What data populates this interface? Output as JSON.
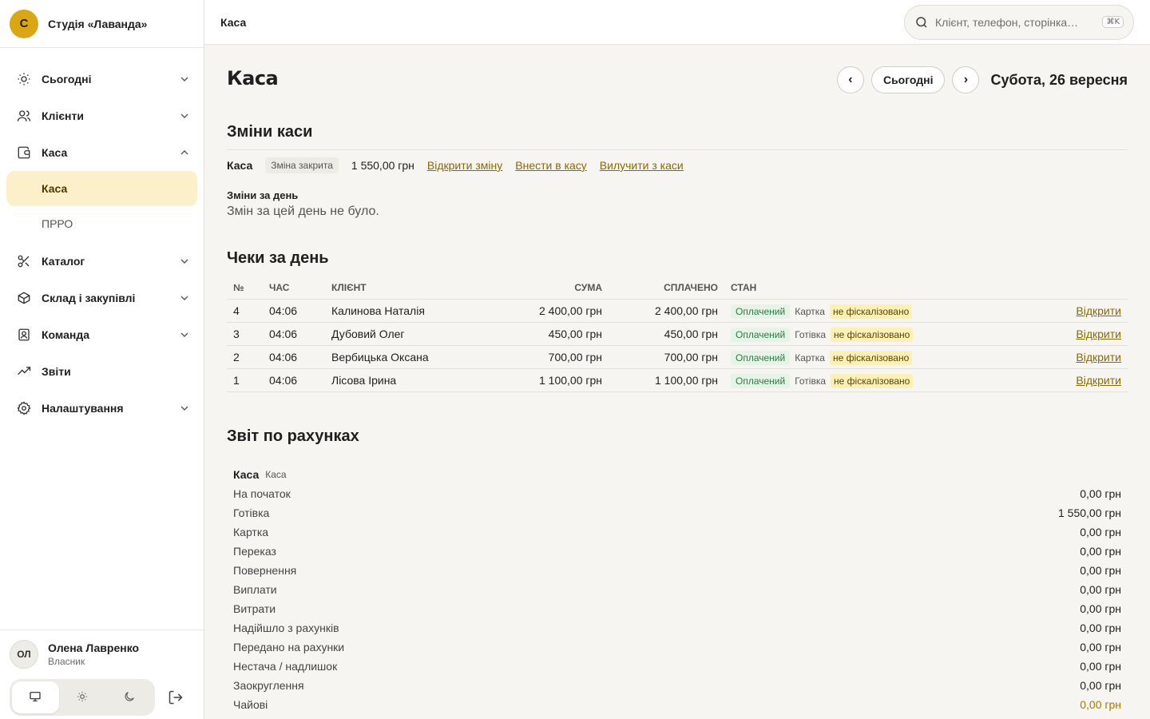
{
  "brand": {
    "initial": "С",
    "name": "Студія «Лаванда»"
  },
  "sidebar": {
    "items": [
      {
        "label": "Сьогодні"
      },
      {
        "label": "Клієнти"
      },
      {
        "label": "Каса"
      },
      {
        "label": "Каталог"
      },
      {
        "label": "Склад і закупівлі"
      },
      {
        "label": "Команда"
      },
      {
        "label": "Звіти"
      },
      {
        "label": "Налаштування"
      }
    ],
    "sub_items": [
      {
        "label": "Каса"
      },
      {
        "label": "ПРРО"
      }
    ]
  },
  "user": {
    "initials": "ОЛ",
    "name": "Олена Лавренко",
    "role": "Власник"
  },
  "topbar": {
    "title": "Каса",
    "search_placeholder": "Клієнт, телефон, сторінка…",
    "shortcut": "⌘K"
  },
  "page": {
    "title": "Каса",
    "prev": "‹",
    "today": "Сьогодні",
    "next": "›",
    "date": "Субота, 26 вересня"
  },
  "shifts": {
    "title": "Зміни каси",
    "register_name": "Каса",
    "status": "Зміна закрита",
    "amount": "1 550,00 грн",
    "open_shift": "Відкрити зміну",
    "deposit": "Внести в касу",
    "withdraw": "Вилучити з каси",
    "day_heading": "Зміни за день",
    "day_empty": "Змін за цей день не було."
  },
  "receipts": {
    "title": "Чеки за день",
    "columns": [
      "№",
      "Час",
      "Клієнт",
      "Сума",
      "Сплачено",
      "Стан"
    ],
    "rows": [
      {
        "no": "4",
        "time": "04:06",
        "client": "Калинова Наталія",
        "sum": "2 400,00 грн",
        "paid": "2 400,00 грн",
        "status": "Оплачений",
        "method": "Картка",
        "fiscal": "не фіскалізовано",
        "action": "Відкрити"
      },
      {
        "no": "3",
        "time": "04:06",
        "client": "Дубовий Олег",
        "sum": "450,00 грн",
        "paid": "450,00 грн",
        "status": "Оплачений",
        "method": "Готівка",
        "fiscal": "не фіскалізовано",
        "action": "Відкрити"
      },
      {
        "no": "2",
        "time": "04:06",
        "client": "Вербицька Оксана",
        "sum": "700,00 грн",
        "paid": "700,00 грн",
        "status": "Оплачений",
        "method": "Картка",
        "fiscal": "не фіскалізовано",
        "action": "Відкрити"
      },
      {
        "no": "1",
        "time": "04:06",
        "client": "Лісова Ірина",
        "sum": "1 100,00 грн",
        "paid": "1 100,00 грн",
        "status": "Оплачений",
        "method": "Готівка",
        "fiscal": "не фіскалізовано",
        "action": "Відкрити"
      }
    ]
  },
  "accounts": {
    "title": "Звіт по рахунках",
    "account_name": "Каса",
    "account_type": "Каса",
    "rows": [
      {
        "label": "На початок",
        "value": "0,00 грн"
      },
      {
        "label": "Готівка",
        "value": "1 550,00 грн"
      },
      {
        "label": "Картка",
        "value": "0,00 грн"
      },
      {
        "label": "Переказ",
        "value": "0,00 грн"
      },
      {
        "label": "Повернення",
        "value": "0,00 грн"
      },
      {
        "label": "Виплати",
        "value": "0,00 грн"
      },
      {
        "label": "Витрати",
        "value": "0,00 грн"
      },
      {
        "label": "Надійшло з рахунків",
        "value": "0,00 грн"
      },
      {
        "label": "Передано на рахунки",
        "value": "0,00 грн"
      },
      {
        "label": "Нестача / надлишок",
        "value": "0,00 грн"
      },
      {
        "label": "Заокруглення",
        "value": "0,00 грн"
      },
      {
        "label": "Чайові",
        "value": "0,00 грн"
      }
    ]
  },
  "colors": {
    "accent": "#d8a712",
    "active_bg": "#fbf0c9",
    "link": "#8a6a00",
    "paid": "#2d7a3e",
    "fiscal_bg": "#fdf0b6"
  }
}
